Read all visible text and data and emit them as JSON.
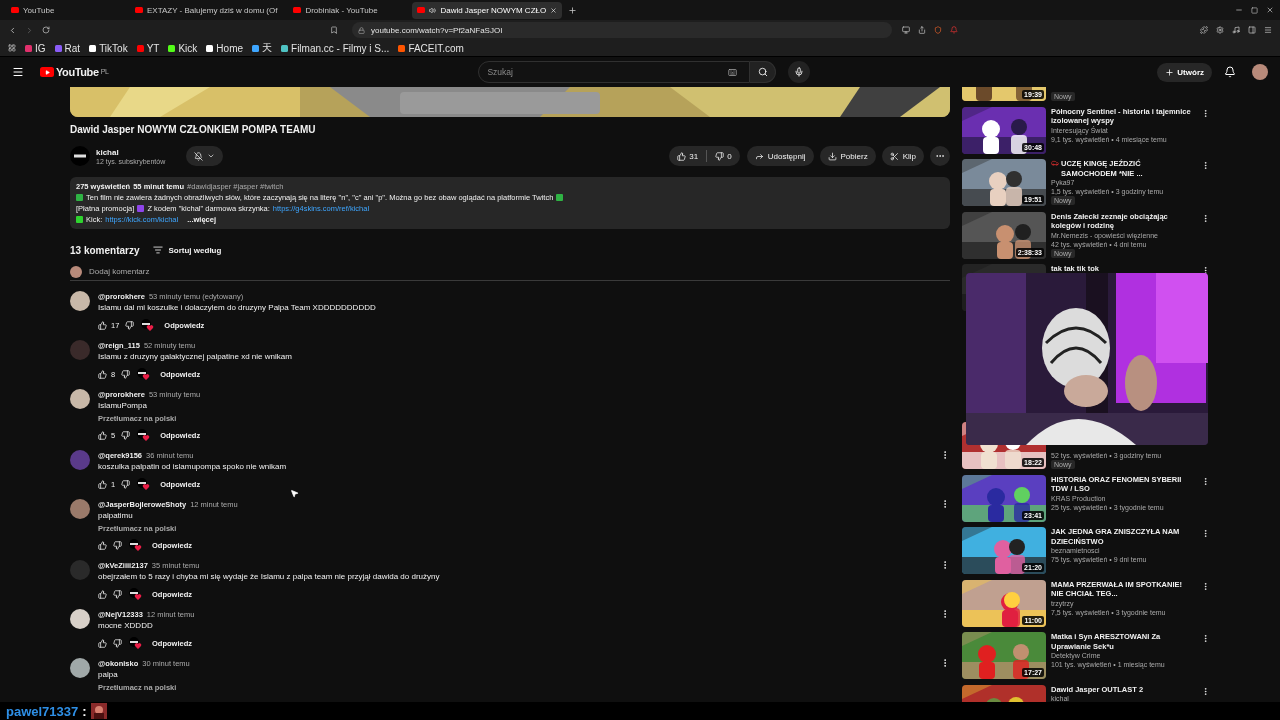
{
  "browser": {
    "tabs": [
      {
        "title": "YouTube",
        "selected": false
      },
      {
        "title": "EXTAZY - Balujemy dziś w domu (Of",
        "selected": false
      },
      {
        "title": "Drobiniak - YouTube",
        "selected": false
      },
      {
        "title": "Dawid Jasper NOWYM CZŁO",
        "selected": true
      }
    ],
    "address": "youtube.com/watch?v=Pf2aNFaSJOI",
    "bookmarks": [
      {
        "label": "IG",
        "color": "#e1306c"
      },
      {
        "label": "Rat",
        "color": "#8a5cf6"
      },
      {
        "label": "TikTok",
        "color": "#ffffff"
      },
      {
        "label": "YT",
        "color": "#ff0000"
      },
      {
        "label": "Kick",
        "color": "#53fc18"
      },
      {
        "label": "Home",
        "color": "#ffffff"
      },
      {
        "label": "天",
        "color": "#3ea6ff"
      },
      {
        "label": "Filman.cc - Filmy i S...",
        "color": "#4fc3c3"
      },
      {
        "label": "FACEIT.com",
        "color": "#ff5500"
      }
    ]
  },
  "header": {
    "logo": "YouTube",
    "region": "PL",
    "search": {
      "placeholder": "Szukaj"
    },
    "create": "Utwórz"
  },
  "video": {
    "title": "Dawid Jasper NOWYM CZŁONKIEM POMPA TEAMU",
    "channel": {
      "name": "kichal",
      "subscribers": "12 tys. subskrybentów"
    },
    "likes": "31",
    "dislikes": "0",
    "actions": [
      {
        "label": "Udostępnij",
        "kind": "share"
      },
      {
        "label": "Pobierz",
        "kind": "download"
      },
      {
        "label": "Klip",
        "kind": "clip"
      }
    ],
    "description": {
      "views": "275 wyświetleń",
      "age": "55 minut temu",
      "tags": "#dawidjasper #jasper #twitch",
      "lines": [
        [
          {
            "kind": "mark",
            "color": "#2fb344"
          },
          {
            "kind": "text",
            "text": "Ten film nie zawiera żadnych obraźliwych słów, które zaczynają się na literę \"n\", \"c\" ani \"p\". Można go bez obaw oglądać na platformie Twitch"
          },
          {
            "kind": "mark",
            "color": "#2fb344"
          }
        ],
        [
          {
            "kind": "text",
            "text": "[Płatna promocja]"
          },
          {
            "kind": "mark",
            "color": "#8e44e8"
          },
          {
            "kind": "text",
            "text": "Z kodem \"kichal\" darmowa skrzynka:"
          },
          {
            "kind": "link",
            "text": "https://g4skins.com/ref/kichal"
          }
        ],
        [
          {
            "kind": "mark",
            "color": "#2fd32f"
          },
          {
            "kind": "text",
            "text": "Kick:"
          },
          {
            "kind": "link",
            "text": "https://kick.com/kichal"
          },
          {
            "kind": "more",
            "text": "...więcej"
          }
        ]
      ]
    }
  },
  "comments": {
    "count": "13 komentarzy",
    "sort": "Sortuj według",
    "add_placeholder": "Dodaj komentarz",
    "items": [
      {
        "handle": "@prorokhere",
        "time": "53 minuty temu (edytowany)",
        "text": "Islamu dal mi koszulke i dolaczylem do druzyny Palpa Team XDDDDDDDDDD",
        "likes": "17",
        "reply": "Odpowiedz",
        "menu": false,
        "actions": true
      },
      {
        "handle": "@reign_115",
        "time": "52 minuty temu",
        "text": "Islamu z druzyny galaktycznej palpatine xd nie wnikam",
        "likes": "8",
        "reply": "Odpowiedz",
        "menu": false,
        "actions": true
      },
      {
        "handle": "@prorokhere",
        "time": "53 minuty temu",
        "text": "IslamuPompa",
        "translate": "Przetłumacz na polski",
        "likes": "5",
        "reply": "Odpowiedz",
        "menu": false,
        "actions": true
      },
      {
        "handle": "@qerek9156",
        "time": "36 minut temu",
        "text": "koszulka palpatin od islamupompa spoko nie wnikam",
        "likes": "1",
        "reply": "Odpowiedz",
        "menu": true,
        "actions": true
      },
      {
        "handle": "@JasperBojleroweShoty",
        "time": "12 minut temu",
        "text": "palpatimu",
        "translate": "Przetłumacz na polski",
        "reply": "Odpowiedz",
        "menu": true,
        "actions": true
      },
      {
        "handle": "@kVeZiiii2137",
        "time": "35 minut temu",
        "text": "obejrzałem to 5 razy i chyba mi się  wydaje że Islamu z palpa team nie przyjął dawida do drużyny",
        "reply": "Odpowiedz",
        "menu": true,
        "actions": true
      },
      {
        "handle": "@NejV12333",
        "time": "12 minut temu",
        "text": "mocne XDDDD",
        "reply": "Odpowiedz",
        "menu": true,
        "actions": true
      },
      {
        "handle": "@okonisko",
        "time": "30 minut temu",
        "text": "palpa",
        "translate": "Przetłumacz na polski",
        "menu": true,
        "actions": false
      }
    ]
  },
  "sidebar": [
    {
      "duration": "19:39",
      "badge": "Nowy"
    },
    {
      "title": "Północny Sentinel - historia i tajemnice izolowanej wyspy",
      "channel": "Interesujący Świat",
      "stats": "9,1 tys. wyświetleń • 4 miesiące temu",
      "duration": "30:48"
    },
    {
      "title": "UCZĘ KINGĘ JEŹDZIĆ SAMOCHODEM *NIE ...",
      "emoji": true,
      "channel": "Pyka97",
      "stats": "1,5 tys. wyświetleń • 3 godziny temu",
      "badge": "Nowy",
      "duration": "19:51"
    },
    {
      "title": "Denis Załecki zeznaje obciążając kolegów i rodzinę",
      "channel": "Mr.Nemezis - opowieści więzienne",
      "stats": "42 tys. wyświetleń • 4 dni temu",
      "badge": "Nowy",
      "duration": "2:38:33"
    },
    {
      "title": "tak tak tik tok"
    },
    {
      "stats": "52 tys. wyświetleń • 3 godziny temu",
      "badge": "Nowy",
      "duration": "18:22"
    },
    {
      "title": "HISTORIA ORAZ FENOMEN SYBERII TDW / LSO",
      "channel": "KRAS Production",
      "stats": "25 tys. wyświetleń • 3 tygodnie temu",
      "duration": "23:41"
    },
    {
      "title": "JAK JEDNA GRA ZNISZCZYŁA NAM DZIECIŃSTWO",
      "channel": "beznamietnosci",
      "stats": "75 tys. wyświetleń • 9 dni temu",
      "duration": "21:20"
    },
    {
      "title": "MAMA PRZERWAŁA IM SPOTKANIE! NIE CHCIAŁ TEG...",
      "channel": "trzytrzy",
      "stats": "7,5 tys. wyświetleń • 3 tygodnie temu",
      "duration": "11:00"
    },
    {
      "title": "Matka i Syn ARESZTOWANI Za Uprawianie Sek*u",
      "channel": "Detektyw Crime",
      "stats": "101 tys. wyświetleń • 1 miesiąc temu",
      "duration": "17:27"
    },
    {
      "title": "Dawid Jasper OUTLAST 2",
      "channel": "kichal"
    }
  ],
  "chat": {
    "user": "pawel71337",
    "separator": ":"
  }
}
